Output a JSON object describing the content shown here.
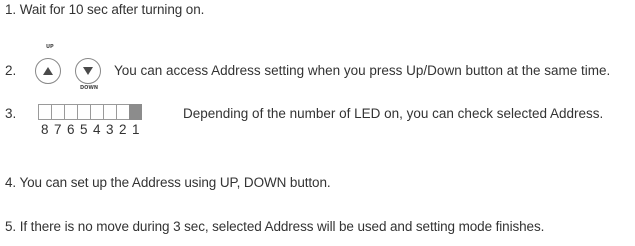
{
  "steps": {
    "step1": "1. Wait for 10 sec after turning on.",
    "step2_number": "2.",
    "step2_text": "You can access Address setting when you press Up/Down button at the same time.",
    "step3_number": "3.",
    "step3_text": "Depending of the number of LED on, you can check selected Address.",
    "step4": "4. You can set up the Address using UP, DOWN button.",
    "step5": "5. If there is no move during 3 sec, selected Address will be used and setting mode finishes."
  },
  "buttons": {
    "up_label": "UP",
    "down_label": "DOWN"
  },
  "led": {
    "labels": [
      "8",
      "7",
      "6",
      "5",
      "4",
      "3",
      "2",
      "1"
    ],
    "states": [
      false,
      false,
      false,
      false,
      false,
      false,
      false,
      true
    ]
  },
  "colors": {
    "text": "#333333",
    "led_on": "#8c8c8c",
    "led_border": "#9a9a9a"
  }
}
